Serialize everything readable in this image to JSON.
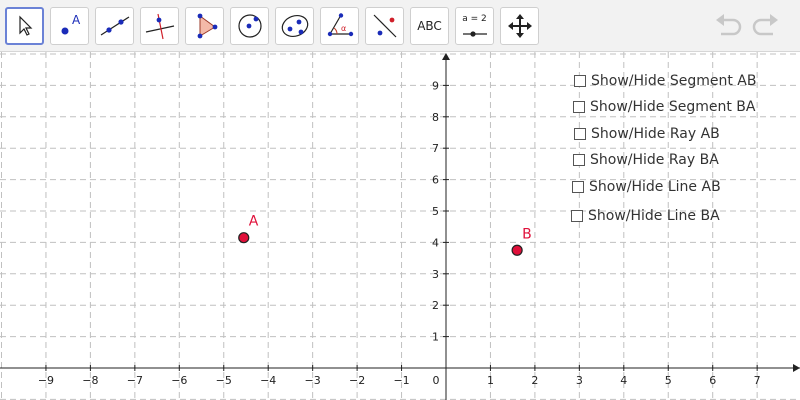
{
  "toolbar": {
    "tools": [
      {
        "name": "move-tool",
        "icon": "arrow-cursor-icon"
      },
      {
        "name": "point-tool",
        "icon": "point-icon",
        "label": "A"
      },
      {
        "name": "line-tool",
        "icon": "line-through-points-icon"
      },
      {
        "name": "perpendicular-line-tool",
        "icon": "perpendicular-line-icon"
      },
      {
        "name": "polygon-tool",
        "icon": "triangle-icon"
      },
      {
        "name": "circle-tool",
        "icon": "circle-center-point-icon"
      },
      {
        "name": "conic-tool",
        "icon": "ellipse-icon"
      },
      {
        "name": "angle-tool",
        "icon": "angle-icon",
        "label": "α"
      },
      {
        "name": "reflect-tool",
        "icon": "reflect-about-line-icon"
      },
      {
        "name": "text-tool",
        "icon": "text-icon",
        "label": "ABC"
      },
      {
        "name": "slider-tool",
        "icon": "slider-icon",
        "label": "a = 2"
      },
      {
        "name": "move-graphics-view-tool",
        "icon": "move-arrows-icon"
      }
    ],
    "undo_icon": "undo-icon",
    "redo_icon": "redo-icon"
  },
  "checkboxes": [
    {
      "label": "Show/Hide Segment AB",
      "checked": false
    },
    {
      "label": "Show/Hide Segment BA",
      "checked": false
    },
    {
      "label": "Show/Hide Ray AB",
      "checked": false
    },
    {
      "label": "Show/Hide Ray BA",
      "checked": false
    },
    {
      "label": "Show/Hide Line AB",
      "checked": false
    },
    {
      "label": "Show/Hide Line BA",
      "checked": false
    }
  ],
  "axes": {
    "x_ticks": [
      "−9",
      "−8",
      "−7",
      "−6",
      "−5",
      "−4",
      "−3",
      "−2",
      "−1",
      "0",
      "1",
      "2",
      "3",
      "4",
      "5",
      "6",
      "7"
    ],
    "y_ticks": [
      "1",
      "2",
      "3",
      "4",
      "5",
      "6",
      "7",
      "8",
      "9"
    ],
    "grid": true
  },
  "points": [
    {
      "label": "A",
      "x": -4.55,
      "y": 4.15,
      "color": "#e0103a"
    },
    {
      "label": "B",
      "x": 1.6,
      "y": 3.75,
      "color": "#e0103a"
    }
  ],
  "colors": {
    "point_fill": "#e0103a",
    "label": "#e0103a",
    "grid": "#c0c0c0",
    "axis": "#222222",
    "active_tool_border": "#6b82d6",
    "icon_blue": "#1a2bb8"
  }
}
